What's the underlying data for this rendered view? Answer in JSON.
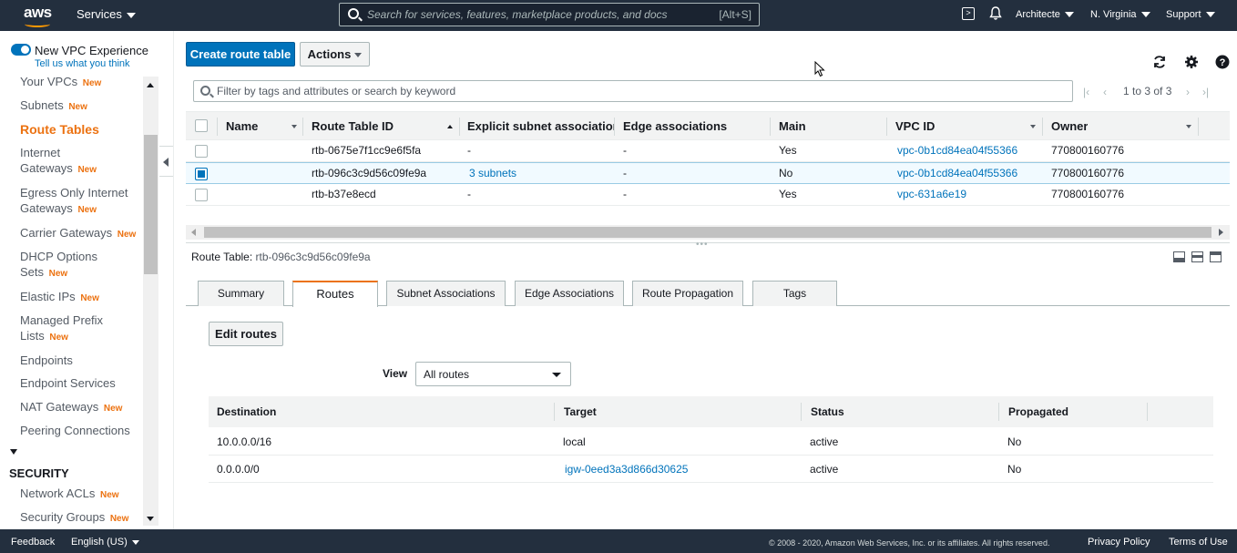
{
  "topnav": {
    "logo_text": "aws",
    "services_label": "Services",
    "search_placeholder": "Search for services, features, marketplace products, and docs",
    "search_shortcut": "[Alt+S]",
    "account_label": "Architecte",
    "region_label": "N. Virginia",
    "support_label": "Support"
  },
  "sidebar": {
    "new_experience_label": "New VPC Experience",
    "tell_us_link": "Tell us what you think",
    "new_badge": "New",
    "items": [
      {
        "label": "Your VPCs",
        "new": true
      },
      {
        "label": "Subnets",
        "new": true
      },
      {
        "label": "Route Tables",
        "new": false,
        "active": true
      },
      {
        "label": "Internet Gateways",
        "new": true
      },
      {
        "label": "Egress Only Internet Gateways",
        "new": true
      },
      {
        "label": "Carrier Gateways",
        "new": true
      },
      {
        "label": "DHCP Options Sets",
        "new": true
      },
      {
        "label": "Elastic IPs",
        "new": true
      },
      {
        "label": "Managed Prefix Lists",
        "new": true
      },
      {
        "label": "Endpoints",
        "new": false
      },
      {
        "label": "Endpoint Services",
        "new": false
      },
      {
        "label": "NAT Gateways",
        "new": true
      },
      {
        "label": "Peering Connections",
        "new": false
      }
    ],
    "section_security": "SECURITY",
    "security_items": [
      {
        "label": "Network ACLs",
        "new": true
      },
      {
        "label": "Security Groups",
        "new": true
      }
    ]
  },
  "toolbar": {
    "create_label": "Create route table",
    "actions_label": "Actions"
  },
  "filter": {
    "placeholder": "Filter by tags and attributes or search by keyword"
  },
  "pager": {
    "text": "1 to 3 of 3"
  },
  "grid": {
    "headers": [
      "Name",
      "Route Table ID",
      "Explicit subnet associatior",
      "Edge associations",
      "Main",
      "VPC ID",
      "Owner"
    ],
    "rows": [
      {
        "name": "",
        "id": "rtb-0675e7f1cc9e6f5fa",
        "subnet": "-",
        "edge": "-",
        "main": "Yes",
        "vpc": "vpc-0b1cd84ea04f55366",
        "owner": "770800160776",
        "selected": false
      },
      {
        "name": "",
        "id": "rtb-096c3c9d56c09fe9a",
        "subnet": "3 subnets",
        "edge": "-",
        "main": "No",
        "vpc": "vpc-0b1cd84ea04f55366",
        "owner": "770800160776",
        "selected": true
      },
      {
        "name": "",
        "id": "rtb-b37e8ecd",
        "subnet": "-",
        "edge": "-",
        "main": "Yes",
        "vpc": "vpc-631a6e19",
        "owner": "770800160776",
        "selected": false
      }
    ]
  },
  "detail": {
    "title_label": "Route Table:",
    "title_id": "rtb-096c3c9d56c09fe9a",
    "tabs": [
      "Summary",
      "Routes",
      "Subnet Associations",
      "Edge Associations",
      "Route Propagation",
      "Tags"
    ],
    "active_tab": "Routes",
    "edit_routes_label": "Edit routes",
    "view_label": "View",
    "view_value": "All routes",
    "routes_headers": [
      "Destination",
      "Target",
      "Status",
      "Propagated"
    ],
    "routes": [
      {
        "destination": "10.0.0.0/16",
        "target": "local",
        "status": "active",
        "propagated": "No"
      },
      {
        "destination": "0.0.0.0/0",
        "target": "igw-0eed3a3d866d30625",
        "status": "active",
        "propagated": "No"
      }
    ]
  },
  "footer": {
    "feedback": "Feedback",
    "language": "English (US)",
    "copyright": "© 2008 - 2020, Amazon Web Services, Inc. or its affiliates. All rights reserved.",
    "privacy": "Privacy Policy",
    "terms": "Terms of Use"
  },
  "colors": {
    "nav_bg": "#232f3e",
    "primary": "#0073bb",
    "accent": "#ec7211"
  }
}
